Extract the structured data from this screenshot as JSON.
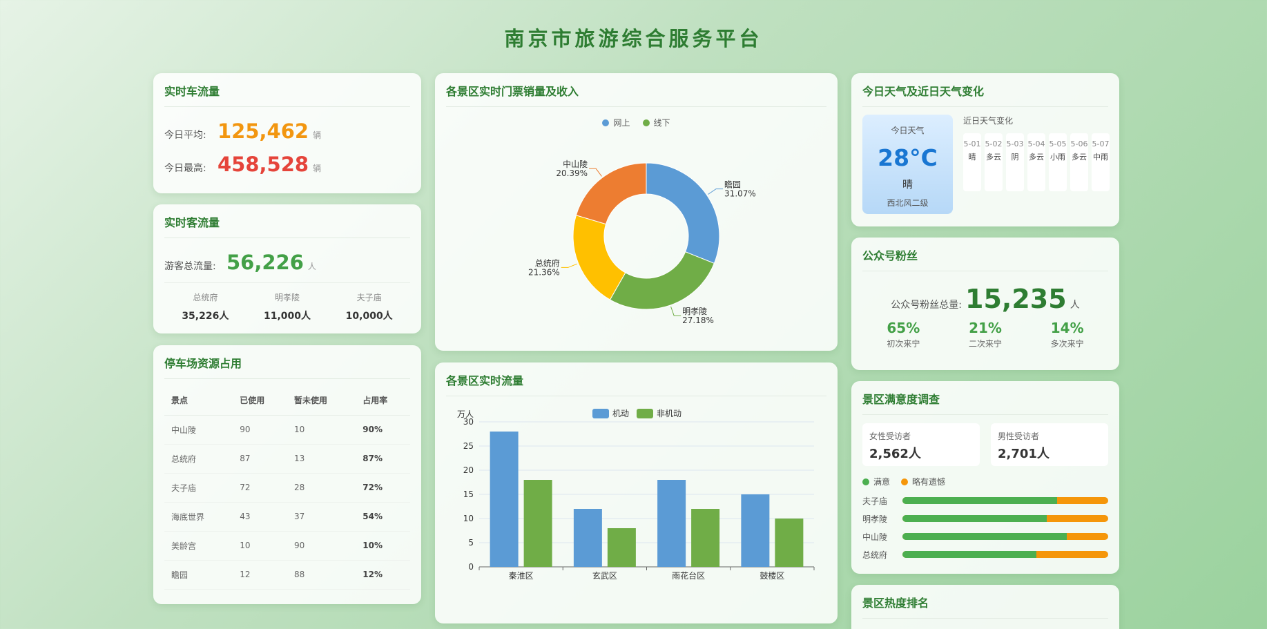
{
  "page_title": "南京市旅游综合服务平台",
  "car_flow": {
    "title": "实时车流量",
    "avg_label": "今日平均:",
    "avg_value": "125,462",
    "max_label": "今日最高:",
    "max_value": "458,528",
    "unit": "辆"
  },
  "passenger_flow": {
    "title": "实时客流量",
    "total_label": "游客总流量:",
    "total_value": "56,226",
    "unit": "人",
    "sites": [
      {
        "name": "总统府",
        "value": "35,226人"
      },
      {
        "name": "明孝陵",
        "value": "11,000人"
      },
      {
        "name": "夫子庙",
        "value": "10,000人"
      }
    ]
  },
  "parking": {
    "title": "停车场资源占用",
    "headers": [
      "景点",
      "已使用",
      "暂未使用",
      "占用率"
    ],
    "rows": [
      [
        "中山陵",
        "90",
        "10",
        "90%"
      ],
      [
        "总统府",
        "87",
        "13",
        "87%"
      ],
      [
        "夫子庙",
        "72",
        "28",
        "72%"
      ],
      [
        "海底世界",
        "43",
        "37",
        "54%"
      ],
      [
        "美龄宫",
        "10",
        "90",
        "10%"
      ],
      [
        "瞻园",
        "12",
        "88",
        "12%"
      ]
    ]
  },
  "tickets": {
    "title": "各景区实时门票销量及收入",
    "legend": [
      {
        "name": "网上",
        "color": "#5b9bd5"
      },
      {
        "name": "线下",
        "color": "#70ad47"
      }
    ]
  },
  "flow": {
    "title": "各景区实时流量",
    "legend": [
      {
        "name": "机动",
        "color": "#5b9bd5"
      },
      {
        "name": "非机动",
        "color": "#70ad47"
      }
    ]
  },
  "weather": {
    "title": "今日天气及近日天气变化",
    "today_label": "今日天气",
    "temp": "28°C",
    "condition": "晴",
    "wind": "西北风二级",
    "recent_label": "近日天气变化",
    "days": [
      {
        "date": "5-01",
        "cond": "晴"
      },
      {
        "date": "5-02",
        "cond": "多云"
      },
      {
        "date": "5-03",
        "cond": "阴"
      },
      {
        "date": "5-04",
        "cond": "多云"
      },
      {
        "date": "5-05",
        "cond": "小雨"
      },
      {
        "date": "5-06",
        "cond": "多云"
      },
      {
        "date": "5-07",
        "cond": "中雨"
      }
    ]
  },
  "fans": {
    "title": "公众号粉丝",
    "total_label": "公众号粉丝总量:",
    "total_value": "15,235",
    "unit": "人",
    "stats": [
      {
        "pct": "65%",
        "label": "初次来宁"
      },
      {
        "pct": "21%",
        "label": "二次来宁"
      },
      {
        "pct": "14%",
        "label": "多次来宁"
      }
    ]
  },
  "satisfaction": {
    "title": "景区满意度调查",
    "female_label": "女性受访者",
    "female_value": "2,562人",
    "male_label": "男性受访者",
    "male_value": "2,701人",
    "legend_satisfied": "满意",
    "legend_regret": "略有遗憾",
    "color_satisfied": "#4caf50",
    "color_regret": "#f5960a",
    "bars": [
      {
        "name": "夫子庙",
        "satisfied": 0.75
      },
      {
        "name": "明孝陵",
        "satisfied": 0.7
      },
      {
        "name": "中山陵",
        "satisfied": 0.8
      },
      {
        "name": "总统府",
        "satisfied": 0.65
      }
    ]
  },
  "ranking": {
    "title": "景区热度排名"
  },
  "chart_data": [
    {
      "type": "pie",
      "labels": [
        "瞻园",
        "明孝陵",
        "总统府",
        "中山陵"
      ],
      "values": [
        31.07,
        27.18,
        21.36,
        20.39
      ],
      "percent_labels": [
        "31.07%",
        "27.18%",
        "21.36%",
        "20.39%"
      ],
      "colors": [
        "#5b9bd5",
        "#70ad47",
        "#ffc000",
        "#ed7d31"
      ],
      "legend": [
        "网上",
        "线下"
      ]
    },
    {
      "type": "bar",
      "categories": [
        "秦淮区",
        "玄武区",
        "雨花台区",
        "鼓楼区"
      ],
      "series": [
        {
          "name": "机动",
          "values": [
            28,
            12,
            18,
            15
          ],
          "color": "#5b9bd5"
        },
        {
          "name": "非机动",
          "values": [
            18,
            8,
            12,
            10
          ],
          "color": "#70ad47"
        }
      ],
      "ylabel": "万人",
      "ylim": [
        0,
        30
      ],
      "yticks": [
        "0",
        "5",
        "10",
        "15",
        "20",
        "25",
        "30"
      ],
      "grid": true,
      "legend": "top"
    }
  ]
}
